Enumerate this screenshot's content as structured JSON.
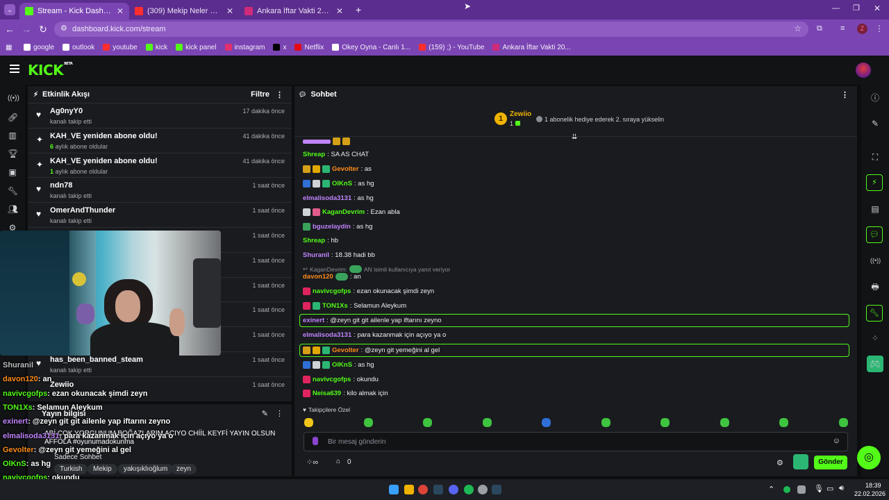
{
  "browser": {
    "tabs": [
      {
        "title": "Stream - Kick Dashboard",
        "color": "#53fc18"
      },
      {
        "title": "(309) Mekip Neler Neler 49.Böl",
        "color": "#ff2d2d"
      },
      {
        "title": "Ankara İftar Vakti 2026 - Ankar",
        "color": "#d02b7a"
      }
    ],
    "new_tab": "+",
    "url": "dashboard.kick.com/stream",
    "profile_initial": "Z",
    "bookmarks": [
      {
        "label": "google",
        "color": "#ffffff"
      },
      {
        "label": "outlook",
        "color": "#ffffff"
      },
      {
        "label": "youtube",
        "color": "#ff2d2d"
      },
      {
        "label": "kick",
        "color": "#53fc18"
      },
      {
        "label": "kick panel",
        "color": "#53fc18"
      },
      {
        "label": "instagram",
        "color": "#e1306c"
      },
      {
        "label": "x",
        "color": "#000000"
      },
      {
        "label": "Netflix",
        "color": "#e50914"
      },
      {
        "label": "Okey Oyna - Canlı 1...",
        "color": "#ffffff"
      },
      {
        "label": "(159) ;) - YouTube",
        "color": "#ff2d2d"
      },
      {
        "label": "Ankara İftar Vakti 20...",
        "color": "#d02b7a"
      }
    ]
  },
  "kick": {
    "logo": "KICK",
    "logo_sup": "BETA"
  },
  "activity": {
    "title": "Etkinlik Akışı",
    "filter": "Filtre",
    "items": [
      {
        "icon": "heart",
        "name": "Ag0nyY0",
        "sub_num": "",
        "sub": "kanalı takip etti",
        "time": "17 dakika önce"
      },
      {
        "icon": "sparkle",
        "name": "KAH_VE yeniden abone oldu!",
        "sub_num": "6",
        "sub": "aylık abone oldular",
        "time": "41 dakika önce"
      },
      {
        "icon": "sparkle",
        "name": "KAH_VE yeniden abone oldu!",
        "sub_num": "1",
        "sub": "aylık abone oldular",
        "time": "41 dakika önce"
      },
      {
        "icon": "heart",
        "name": "ndn78",
        "sub_num": "",
        "sub": "kanalı takip etti",
        "time": "1 saat önce"
      },
      {
        "icon": "heart",
        "name": "OmerAndThunder",
        "sub_num": "",
        "sub": "kanalı takip etti",
        "time": "1 saat önce"
      },
      {
        "icon": "",
        "name": "",
        "sub_num": "",
        "sub": "",
        "time": "1 saat önce"
      },
      {
        "icon": "",
        "name": "",
        "sub_num": "",
        "sub": "",
        "time": "1 saat önce"
      },
      {
        "icon": "",
        "name": "",
        "sub_num": "",
        "sub": "",
        "time": "1 saat önce"
      },
      {
        "icon": "",
        "name": "",
        "sub_num": "",
        "sub": "",
        "time": "1 saat önce"
      },
      {
        "icon": "",
        "name": "",
        "sub_num": "",
        "sub": "",
        "time": "1 saat önce"
      },
      {
        "icon": "heart",
        "name": "has_been_banned_steam",
        "sub_num": "",
        "sub": "kanalı takip etti",
        "time": "1 saat önce"
      },
      {
        "icon": "",
        "name": "Zewiio",
        "sub_num": "",
        "sub": "",
        "time": "1 saat önce"
      }
    ]
  },
  "stream_info": {
    "title": "Yayın bilgisi",
    "stream_title": "ABİ ÇOK YORGUNUM BOĞAZLARIM ACIYO CHİİL KEYFİ YAYIN OLSUN AFFOLA #oyunumadokunma",
    "mode": "Sadece Sohbet",
    "tags": [
      "Turkish",
      "Mekip",
      "yakışıklıoğlum",
      "zeyn"
    ]
  },
  "overlay_chat": [
    {
      "user": "Shuranil",
      "text": "",
      "color": "#bdbdbd"
    },
    {
      "user": "davon120",
      "text": ": an",
      "color": "#ff8c1a"
    },
    {
      "user": "navivcgofps",
      "text": ": ezan okunacak şimdi zeyn",
      "color": "#53fc18"
    },
    {
      "user": "TON1Xs",
      "text": ": Selamun Aleykum",
      "color": "#53fc18"
    },
    {
      "user": "exinert",
      "text": ": @zeyn git git ailenle yap iftarını zeyno",
      "color": "#c084fc"
    },
    {
      "user": "elmalisoda3131",
      "text": ": para kazanmak için açıyo ya o",
      "color": "#c084fc"
    },
    {
      "user": "Gevolter",
      "text": ": @zeyn git yemeğini al gel",
      "color": "#ff8c1a"
    },
    {
      "user": "OlKnS",
      "text": ": as hg",
      "color": "#53fc18"
    },
    {
      "user": "navivcgofps",
      "text": ": okundu",
      "color": "#53fc18"
    },
    {
      "user": "Neisa639",
      "text": ": kilo almak için",
      "color": "#53fc18"
    }
  ],
  "chat": {
    "title": "Sohbet",
    "top_user": "Zewiio",
    "top_rank": "1",
    "top_gifts": "1",
    "top_promo": "1 abonelik hediye ederek 2. sıraya yükselin",
    "messages": [
      {
        "user": "Shreap",
        "text": ": SA AS CHAT",
        "color": "#53fc18",
        "badges": []
      },
      {
        "user": "Gevolter",
        "text": ": as",
        "color": "#ff8c1a",
        "badges": [
          "#d4a017",
          "#e0a800",
          "#2bb673"
        ]
      },
      {
        "user": "OlKnS",
        "text": ": as hg",
        "color": "#53fc18",
        "badges": [
          "#2f6fd6",
          "#cfd3d6",
          "#2bb673"
        ]
      },
      {
        "user": "elmalisoda3131",
        "text": ": as hg",
        "color": "#c084fc",
        "badges": []
      },
      {
        "user": "KaganDevrim",
        "text": ": Ezan abla",
        "color": "#53fc18",
        "badges": [
          "#cfd3d6",
          "#e05c8a"
        ]
      },
      {
        "user": "bguzelaydin",
        "text": ": as hg",
        "color": "#c084fc",
        "badges": [
          "#3aa35b"
        ]
      },
      {
        "user": "Shreap",
        "text": ": hb",
        "color": "#53fc18",
        "badges": []
      },
      {
        "user": "Shuranil",
        "text": ": 18.38 hadi bb",
        "color": "#c084fc",
        "badges": []
      },
      {
        "user": "davon120",
        "text": ": an",
        "color": "#ff8c1a",
        "badges": []
      },
      {
        "user": "navivcgofps",
        "text": ": ezan okunacak şimdi zeyn",
        "color": "#53fc18",
        "badges": [
          "#e0245e"
        ]
      },
      {
        "user": "TON1Xs",
        "text": ": Selamun Aleykum",
        "color": "#53fc18",
        "badges": [
          "#e0245e",
          "#2bb673"
        ]
      },
      {
        "user": "exinert",
        "text": ": @zeyn git git ailenle yap iftarını zeyno",
        "color": "#c084fc",
        "badges": []
      },
      {
        "user": "elmalisoda3131",
        "text": ": para kazanmak için açıyo ya o",
        "color": "#c084fc",
        "badges": []
      },
      {
        "user": "Gevolter",
        "text": ": @zeyn git yemeğini al gel",
        "color": "#ff8c1a",
        "badges": [
          "#d4a017",
          "#e0a800",
          "#2bb673"
        ]
      },
      {
        "user": "OlKnS",
        "text": ": as hg",
        "color": "#53fc18",
        "badges": [
          "#2f6fd6",
          "#cfd3d6",
          "#2bb673"
        ]
      },
      {
        "user": "navivcgofps",
        "text": ": okundu",
        "color": "#53fc18",
        "badges": [
          "#e0245e"
        ]
      },
      {
        "user": "Neisa639",
        "text": ": kilo almak için",
        "color": "#53fc18",
        "badges": [
          "#e0245e"
        ]
      }
    ],
    "reply_user": "KaganDevrim:",
    "reply_text": "AN isimli kullanıcıya yanıt veriyor",
    "followers_only": "Takipçilere Özel",
    "input_placeholder": "Bir mesaj gönderin",
    "points": "0",
    "send_label": "Gönder"
  },
  "taskbar": {
    "time": "18:39",
    "date": "22.02.2026"
  },
  "colors": {
    "kick_green": "#53fc18",
    "browser_purple": "#7a45b3",
    "panel_bg": "#191b1f"
  }
}
